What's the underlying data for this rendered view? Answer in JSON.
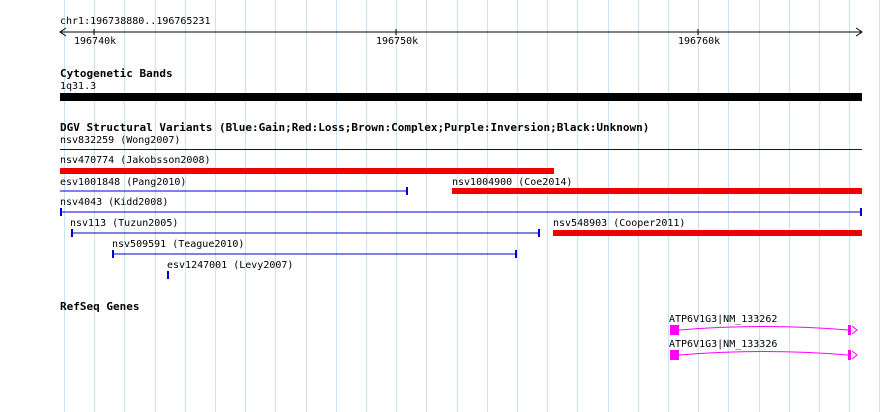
{
  "ruler": {
    "position_label": "chr1:196738880..196765231",
    "ticks": [
      "196740k",
      "196750k",
      "196760k"
    ]
  },
  "tracks": {
    "cytoband": {
      "title": "Cytogenetic Bands",
      "band_label": "1q31.3",
      "band_color": "#000000"
    },
    "dgv": {
      "title": "DGV Structural Variants (Blue:Gain;Red:Loss;Brown:Complex;Purple:Inversion;Black:Unknown)",
      "colors": {
        "gain": "#0000cc",
        "loss": "#ee0000"
      },
      "variants": [
        {
          "label": "nsv832259 (Wong2007)",
          "type": "gain"
        },
        {
          "label": "nsv470774 (Jakobsson2008)",
          "type": "loss"
        },
        {
          "label": "esv1001848 (Pang2010)",
          "type": "gain"
        },
        {
          "label": "nsv1004900 (Coe2014)",
          "type": "loss"
        },
        {
          "label": "nsv4043 (Kidd2008)",
          "type": "gain"
        },
        {
          "label": "nsv113 (Tuzun2005)",
          "type": "gain"
        },
        {
          "label": "nsv548903 (Cooper2011)",
          "type": "loss"
        },
        {
          "label": "nsv509591 (Teague2010)",
          "type": "gain"
        },
        {
          "label": "esv1247001 (Levy2007)",
          "type": "gain"
        }
      ]
    },
    "refseq": {
      "title": "RefSeq Genes",
      "gene_color": "#ff00ff",
      "genes": [
        {
          "label": "ATP6V1G3|NM_133262"
        },
        {
          "label": "ATP6V1G3|NM_133326"
        }
      ]
    }
  }
}
